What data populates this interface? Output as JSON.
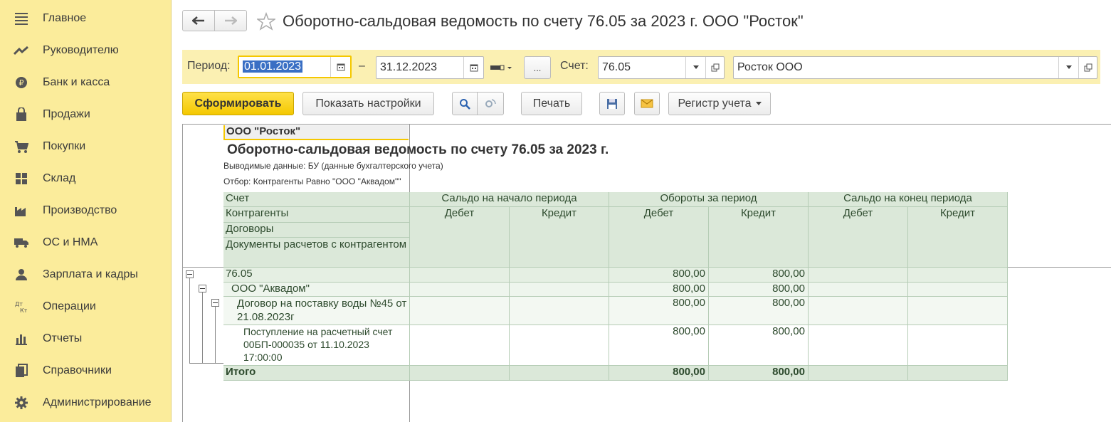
{
  "sidebar": {
    "items": [
      {
        "label": "Главное",
        "icon": "menu-lines-icon"
      },
      {
        "label": "Руководителю",
        "icon": "trend-icon"
      },
      {
        "label": "Банк и касса",
        "icon": "ruble-coin-icon"
      },
      {
        "label": "Продажи",
        "icon": "shopping-bag-icon"
      },
      {
        "label": "Покупки",
        "icon": "cart-icon"
      },
      {
        "label": "Склад",
        "icon": "warehouse-icon"
      },
      {
        "label": "Производство",
        "icon": "factory-icon"
      },
      {
        "label": "ОС и НМА",
        "icon": "truck-icon"
      },
      {
        "label": "Зарплата и кадры",
        "icon": "person-icon"
      },
      {
        "label": "Операции",
        "icon": "dt-kt-icon"
      },
      {
        "label": "Отчеты",
        "icon": "bar-chart-icon"
      },
      {
        "label": "Справочники",
        "icon": "books-icon"
      },
      {
        "label": "Администрирование",
        "icon": "gear-icon"
      }
    ]
  },
  "header": {
    "title": "Оборотно-сальдовая ведомость по счету 76.05 за 2023 г. ООО \"Росток\""
  },
  "params": {
    "period_label": "Период:",
    "date_from": "01.01.2023",
    "dash": "–",
    "date_to": "31.12.2023",
    "dots": "...",
    "account_label": "Счет:",
    "account": "76.05",
    "org": "Росток ООО"
  },
  "toolbar": {
    "generate": "Сформировать",
    "show_settings": "Показать настройки",
    "print": "Печать",
    "register": "Регистр учета"
  },
  "report": {
    "org": "ООО \"Росток\"",
    "title": "Оборотно-сальдовая ведомость по счету 76.05 за 2023 г.",
    "output": "Выводимые данные: БУ (данные бухгалтерского учета)",
    "filter": "Отбор: Контрагенты Равно \"ООО \"Аквадом\"\"",
    "head": {
      "account": "Счет",
      "counterparties": "Контрагенты",
      "contracts": "Договоры",
      "documents": "Документы расчетов с контрагентом",
      "open_bal": "Сальдо на начало периода",
      "turnover": "Обороты за период",
      "close_bal": "Сальдо на конец периода",
      "debit": "Дебет",
      "credit": "Кредит"
    },
    "rows": [
      {
        "name": "76.05",
        "turn_debit": "800,00",
        "turn_credit": "800,00"
      },
      {
        "name": "ООО \"Аквадом\"",
        "turn_debit": "800,00",
        "turn_credit": "800,00"
      },
      {
        "name": "Договор на поставку воды №45 от 21.08.2023г",
        "turn_debit": "800,00",
        "turn_credit": "800,00"
      },
      {
        "name": "Поступление на расчетный счет 00БП-000035 от 11.10.2023 17:00:00",
        "turn_debit": "800,00",
        "turn_credit": "800,00"
      }
    ],
    "total": {
      "name": "Итого",
      "turn_debit": "800,00",
      "turn_credit": "800,00"
    }
  }
}
